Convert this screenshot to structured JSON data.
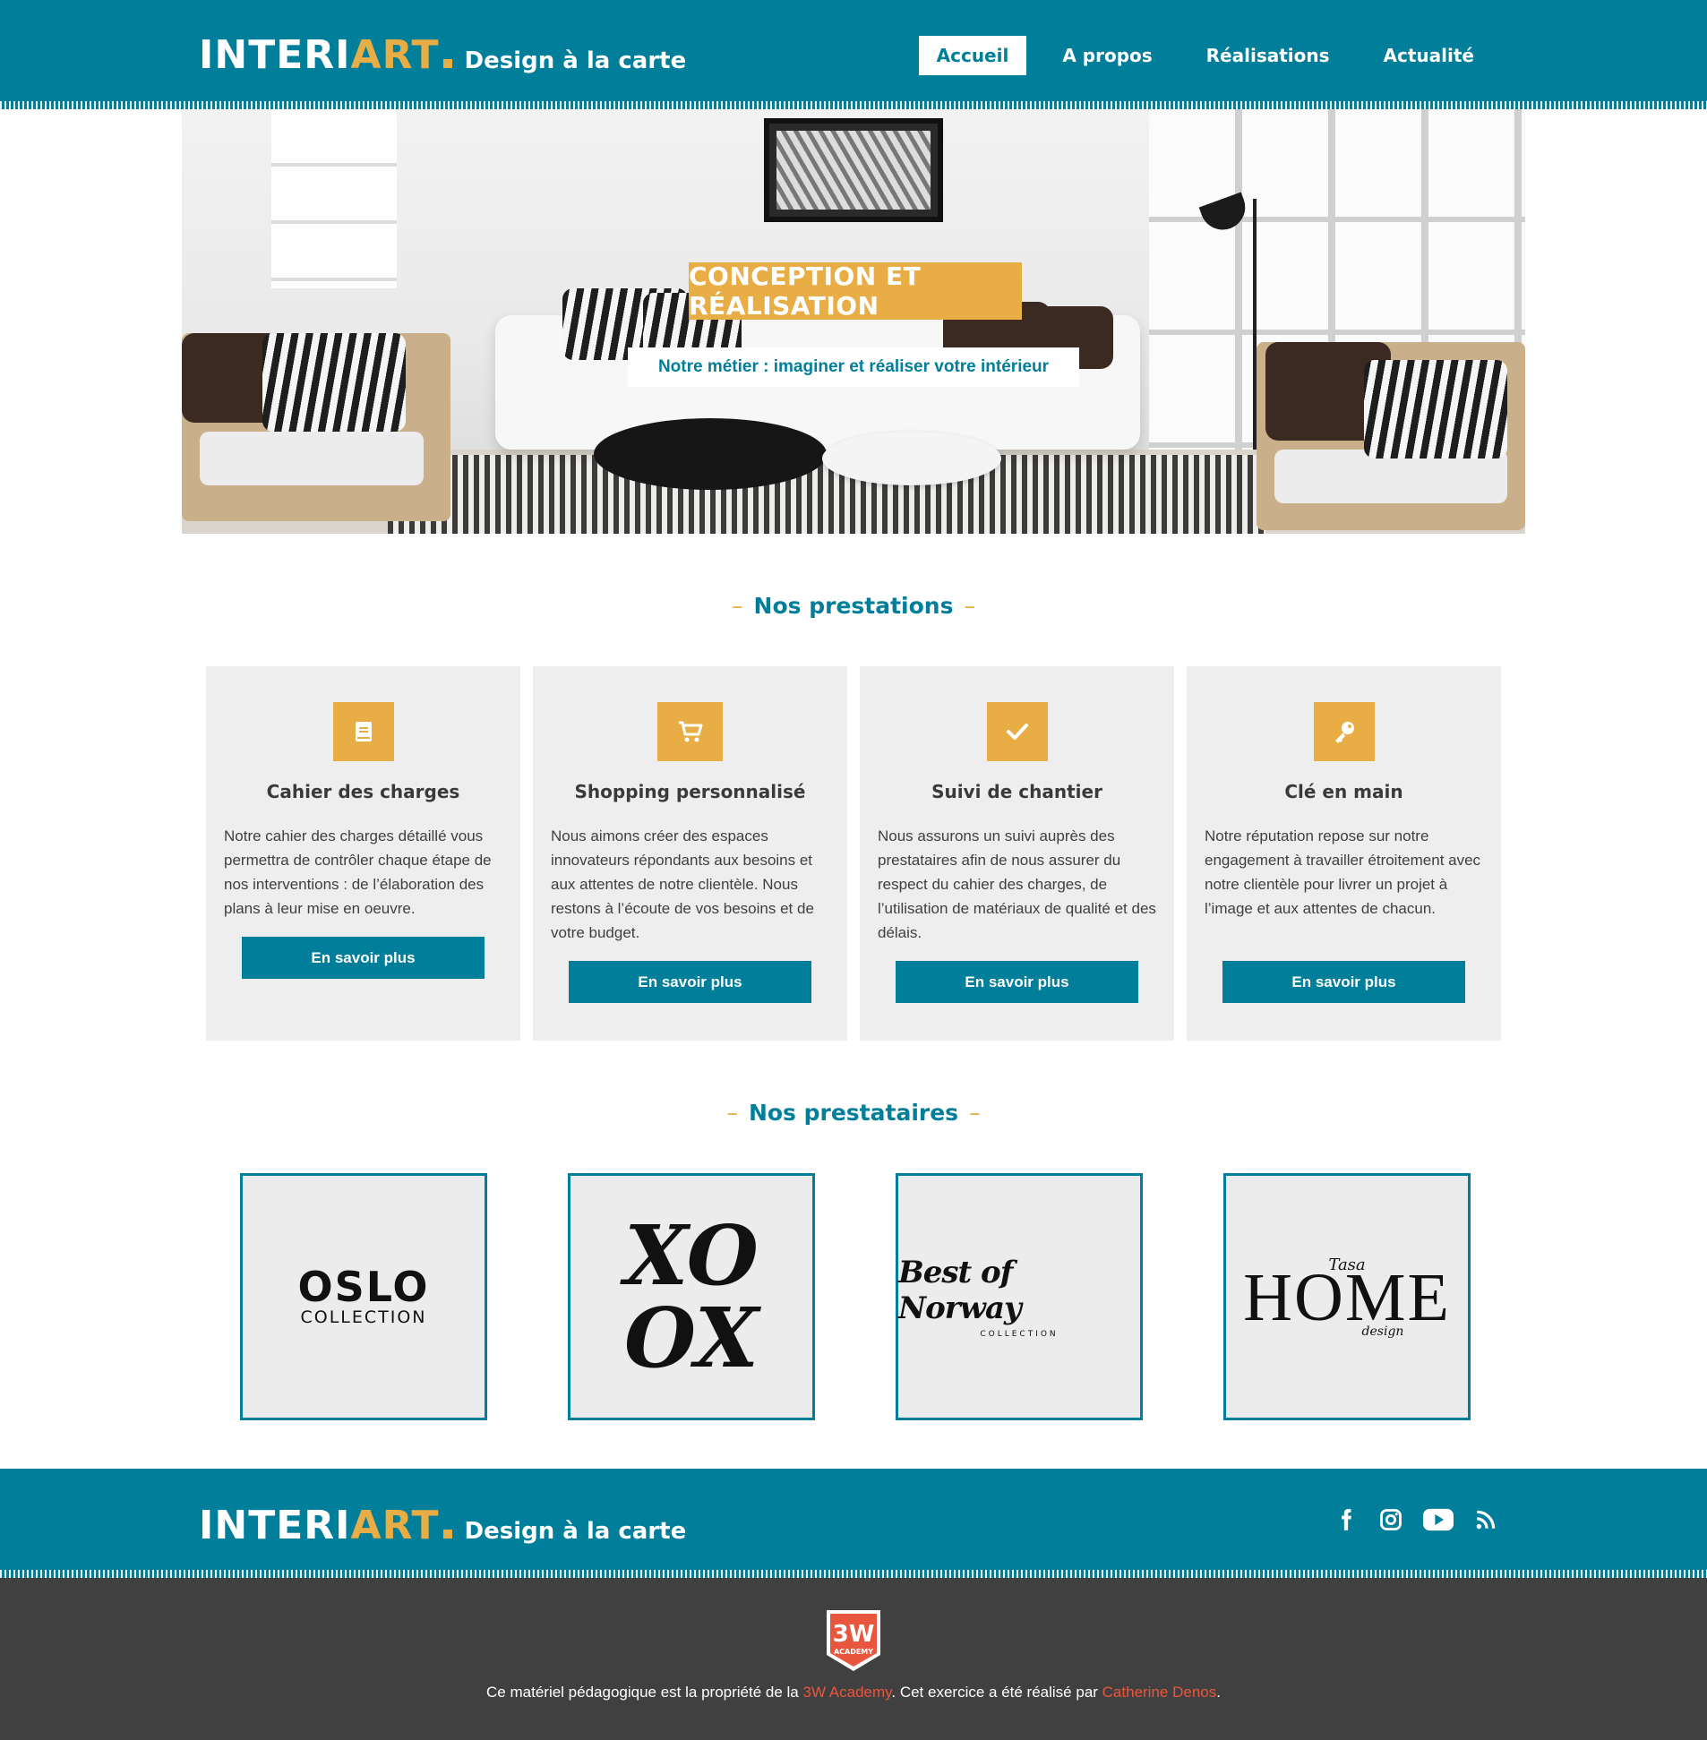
{
  "brand": {
    "logo_interi": "INTERI",
    "logo_art": "ART",
    "tagline": "Design à la carte",
    "colors": {
      "primary": "#007e9a",
      "accent": "#e8ad44",
      "card_bg": "#eeeeee",
      "footer_dark": "#404040",
      "link": "#e8563e"
    }
  },
  "nav": {
    "items": [
      {
        "label": "Accueil",
        "active": true
      },
      {
        "label": "A propos",
        "active": false
      },
      {
        "label": "Réalisations",
        "active": false
      },
      {
        "label": "Actualité",
        "active": false
      }
    ]
  },
  "hero": {
    "title": "CONCEPTION ET RÉALISATION",
    "subtitle": "Notre métier : imaginer et réaliser votre intérieur"
  },
  "services": {
    "heading": "Nos prestations",
    "cards": [
      {
        "icon": "book-icon",
        "title": "Cahier des charges",
        "text": "Notre cahier des charges détaillé vous permettra de contrôler chaque étape de nos interventions : de l’élaboration des plans à leur mise en oeuvre.",
        "button": "En savoir plus"
      },
      {
        "icon": "cart-icon",
        "title": "Shopping personnalisé",
        "text": "Nous aimons créer des espaces innovateurs répondants aux besoins et aux attentes de notre clientèle. Nous restons à l’écoute de vos besoins et de votre budget.",
        "button": "En savoir plus"
      },
      {
        "icon": "check-icon",
        "title": "Suivi de chantier",
        "text": "Nous assurons un suivi auprès des prestataires afin de nous assurer du respect du cahier des charges, de l’utilisation de matériaux de qualité et des délais.",
        "button": "En savoir plus"
      },
      {
        "icon": "key-icon",
        "title": "Clé en main",
        "text": "Notre réputation repose sur notre engagement à travailler étroitement avec notre clientèle pour livrer un projet à l’image et aux attentes de chacun.",
        "button": "En savoir plus"
      }
    ]
  },
  "partners": {
    "heading": "Nos prestataires",
    "logos": [
      {
        "main": "OSLO",
        "sub": "COLLECTION"
      },
      {
        "line1": "XO",
        "line2": "OX"
      },
      {
        "main": "Best of Norway",
        "sub": "COLLECTION"
      },
      {
        "top": "Tasa",
        "main": "HOME",
        "sub": "design"
      }
    ]
  },
  "footer": {
    "socials": [
      "facebook-icon",
      "instagram-icon",
      "youtube-icon",
      "rss-icon"
    ],
    "badge_text": "3W",
    "badge_sub": "ACADEMY",
    "copyright_before": "Ce matériel pédagogique est la propriété de la ",
    "copyright_link1": "3W Academy",
    "copyright_middle": ". Cet exercice a été réalisé par ",
    "copyright_link2": "Catherine Denos",
    "copyright_after": "."
  }
}
